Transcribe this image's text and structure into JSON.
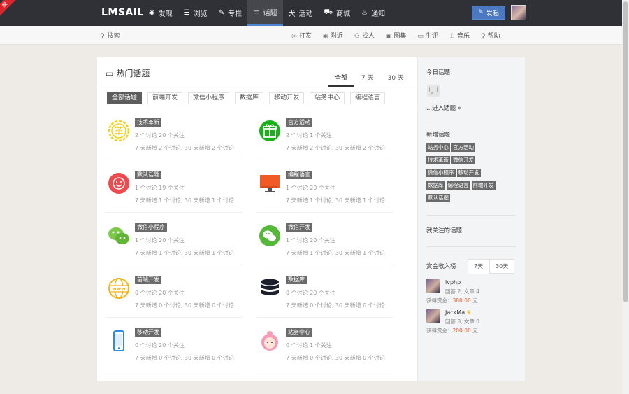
{
  "ribbon": "家",
  "app": {
    "logo": "LMSAIL"
  },
  "nav": [
    {
      "icon": "eye-icon",
      "glyph": "◉",
      "label": "发现"
    },
    {
      "icon": "list-icon",
      "glyph": "☰",
      "label": "浏览"
    },
    {
      "icon": "pen-icon",
      "glyph": "✎",
      "label": "专栏"
    },
    {
      "icon": "chat-icon",
      "glyph": "▭",
      "label": "话题",
      "active": true
    },
    {
      "icon": "activity-icon",
      "glyph": "犬",
      "label": "活动"
    },
    {
      "icon": "cart-icon",
      "glyph": "⛟",
      "label": "商城"
    },
    {
      "icon": "bell-icon",
      "glyph": "♨",
      "label": "通知"
    }
  ],
  "post_button": "发起",
  "search": {
    "placeholder": "搜索"
  },
  "subnav": [
    {
      "icon": "target-icon",
      "glyph": "◎",
      "label": "打赏"
    },
    {
      "icon": "location-icon",
      "glyph": "◉",
      "label": "附近"
    },
    {
      "icon": "people-icon",
      "glyph": "⚇",
      "label": "找人"
    },
    {
      "icon": "image-icon",
      "glyph": "▣",
      "label": "图集"
    },
    {
      "icon": "comment-icon",
      "glyph": "▭",
      "label": "牛评"
    },
    {
      "icon": "headphone-icon",
      "glyph": "♫",
      "label": "音乐"
    },
    {
      "icon": "help-icon",
      "glyph": "♀",
      "label": "帮助"
    }
  ],
  "main": {
    "title": "热门话题",
    "time_tabs": [
      {
        "label": "全部",
        "active": true
      },
      {
        "label": "7 天"
      },
      {
        "label": "30 天"
      }
    ],
    "filters": [
      {
        "label": "全部话题",
        "active": true
      },
      {
        "label": "前端开发"
      },
      {
        "label": "微信小程序"
      },
      {
        "label": "数据库"
      },
      {
        "label": "移动开发"
      },
      {
        "label": "站务中心"
      },
      {
        "label": "编程语言"
      }
    ],
    "topics": [
      {
        "tag": "技术革新",
        "stat1": "2 个讨论 20 个关注",
        "stat2": "7 天新增 2 个讨论, 30 天新增 2 个讨论",
        "icon": "innovation-icon"
      },
      {
        "tag": "官方活动",
        "stat1": "2 个讨论 1 个关注",
        "stat2": "7 天新增 2 个讨论, 30 天新增 2 个讨论",
        "icon": "gift-icon"
      },
      {
        "tag": "默认话题",
        "stat1": "1 个讨论 19 个关注",
        "stat2": "7 天新增 1 个讨论, 30 天新增 1 个讨论",
        "icon": "smile-icon"
      },
      {
        "tag": "编程语言",
        "stat1": "1 个讨论 20 个关注",
        "stat2": "7 天新增 1 个讨论, 30 天新增 1 个讨论",
        "icon": "monitor-icon"
      },
      {
        "tag": "微信小程序",
        "stat1": "1 个讨论 20 个关注",
        "stat2": "7 天新增 1 个讨论, 30 天新增 1 个讨论",
        "icon": "wechat-icon"
      },
      {
        "tag": "微信开发",
        "stat1": "1 个讨论 20 个关注",
        "stat2": "7 天新增 1 个讨论, 30 天新增 1 个讨论",
        "icon": "wechat-circle-icon"
      },
      {
        "tag": "前端开发",
        "stat1": "0 个讨论 20 个关注",
        "stat2": "7 天新增 0 个讨论, 30 天新增 0 个讨论",
        "icon": "globe-www-icon"
      },
      {
        "tag": "数据库",
        "stat1": "0 个讨论 20 个关注",
        "stat2": "7 天新增 0 个讨论, 30 天新增 0 个讨论",
        "icon": "database-icon"
      },
      {
        "tag": "移动开发",
        "stat1": "0 个讨论 20 个关注",
        "stat2": "7 天新增 0 个讨论, 30 天新增 0 个讨论",
        "icon": "phone-icon"
      },
      {
        "tag": "站务中心",
        "stat1": "0 个讨论 1 个关注",
        "stat2": "7 天新增 0 个讨论, 30 天新增 0 个讨论",
        "icon": "girl-icon"
      }
    ]
  },
  "side": {
    "today_title": "今日话题",
    "enter_link": "...进入话题 »",
    "new_title": "新增话题",
    "new_tags": [
      "站务中心",
      "官方活动",
      "技术革新",
      "微信开发",
      "微信小程序",
      "移动开发",
      "数据库",
      "编程语言",
      "前端开发",
      "默认话题"
    ],
    "follow_title": "我关注的话题",
    "rank_title": "赏金收入榜",
    "rank_tabs": [
      {
        "label": "7天",
        "active": true
      },
      {
        "label": "30天"
      }
    ],
    "users": [
      {
        "name": "lvphp",
        "meta": "回答 2, 文章 4",
        "reward_label": "获得赏金：",
        "amount": "380.00",
        "unit": " 元"
      },
      {
        "name": "JackMa",
        "vip": "♛",
        "meta": "回答 8, 文章 0",
        "reward_label": "获得赏金：",
        "amount": "200.00",
        "unit": " 元"
      }
    ]
  }
}
